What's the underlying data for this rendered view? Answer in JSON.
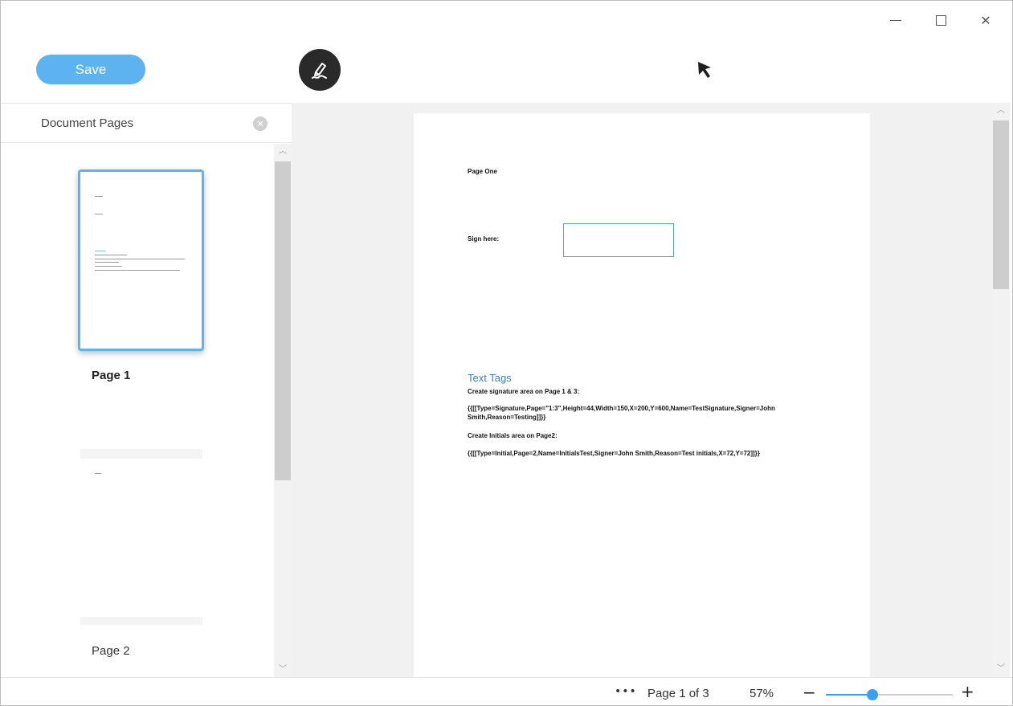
{
  "window": {
    "minimize_icon": "minimize-icon",
    "maximize_icon": "maximize-icon",
    "close_glyph": "✕"
  },
  "toolbar": {
    "save_label": "Save",
    "sign_icon": "pen-signature-icon"
  },
  "sidebar": {
    "title": "Document Pages",
    "close_glyph": "✕",
    "thumbnails": [
      {
        "label": "Page 1",
        "selected": true
      },
      {
        "label": "Page 2",
        "selected": false
      }
    ]
  },
  "document": {
    "page_heading": "Page One",
    "sign_label": "Sign here:",
    "tags_heading": "Text Tags",
    "line1": "Create signature area on Page 1 & 3:",
    "line2a": "{{[[Type=Signature,Page=\"1:3\",Height=44,Width=150,X=200,Y=600,Name=TestSignature,Signer=John",
    "line2b": "Smith,Reason=Testing]]}}",
    "line3": "Create Initials area on Page2:",
    "line4": "{{[[Type=Initial,Page=2,Name=InitialsTest,Signer=John Smith,Reason=Test initials,X=72,Y=72]]}}"
  },
  "statusbar": {
    "more_label": "•••",
    "page_indicator": "Page 1 of 3",
    "zoom_level": "57%",
    "zoom_out_glyph": "−",
    "zoom_in_glyph": "+",
    "zoom_slider_fraction": 0.37
  },
  "colors": {
    "accent": "#5cb3ef",
    "slider": "#39a0f0",
    "sign_button_bg": "#2a2a2a",
    "link_heading": "#3b7fc4"
  }
}
